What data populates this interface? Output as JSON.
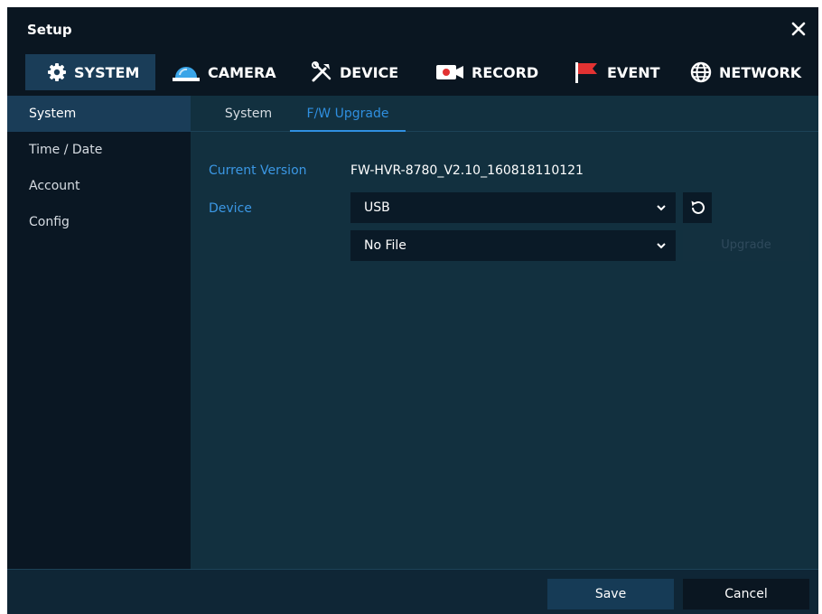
{
  "window": {
    "title": "Setup"
  },
  "top_tabs": [
    {
      "label": "SYSTEM",
      "icon": "gear-icon",
      "active": true
    },
    {
      "label": "CAMERA",
      "icon": "camera-dome-icon",
      "active": false
    },
    {
      "label": "DEVICE",
      "icon": "tools-icon",
      "active": false
    },
    {
      "label": "RECORD",
      "icon": "record-camera-icon",
      "active": false
    },
    {
      "label": "EVENT",
      "icon": "flag-icon",
      "active": false
    },
    {
      "label": "NETWORK",
      "icon": "globe-icon",
      "active": false
    }
  ],
  "sidebar": {
    "items": [
      {
        "label": "System",
        "active": true
      },
      {
        "label": "Time / Date",
        "active": false
      },
      {
        "label": "Account",
        "active": false
      },
      {
        "label": "Config",
        "active": false
      }
    ]
  },
  "sub_tabs": [
    {
      "label": "System",
      "active": false
    },
    {
      "label": "F/W Upgrade",
      "active": true
    }
  ],
  "fw_upgrade": {
    "current_version_label": "Current Version",
    "current_version_value": "FW-HVR-8780_V2.10_160818110121",
    "device_label": "Device",
    "device_selected": "USB",
    "file_selected": "No File",
    "upgrade_label": "Upgrade"
  },
  "footer": {
    "save_label": "Save",
    "cancel_label": "Cancel"
  },
  "colors": {
    "accent": "#2f8fe0",
    "label_blue": "#3b97e4",
    "flag_red": "#e23232",
    "camera_blue": "#3aa5e8"
  }
}
